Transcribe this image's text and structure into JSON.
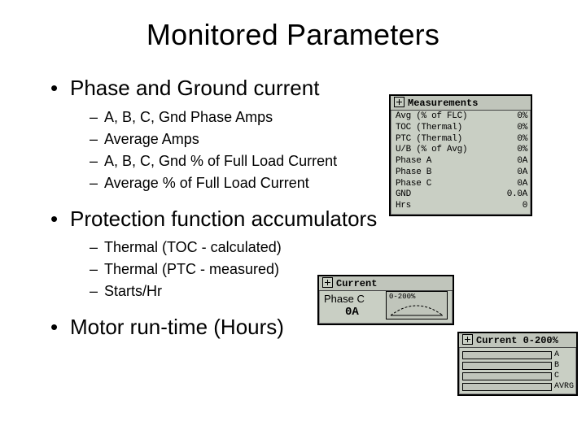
{
  "title": "Monitored Parameters",
  "section1": {
    "heading": "Phase and Ground current",
    "items": [
      "A, B, C, Gnd Phase Amps",
      "Average Amps",
      "A, B, C, Gnd % of Full Load Current",
      "Average % of Full Load Current"
    ]
  },
  "section2": {
    "heading": "Protection function accumulators",
    "items": [
      "Thermal (TOC - calculated)",
      "Thermal (PTC - measured)",
      "Starts/Hr"
    ]
  },
  "section3": {
    "heading": "Motor run-time (Hours)"
  },
  "panel": {
    "measurements": {
      "title": "Measurements",
      "rows": [
        {
          "label": "Avg (% of FLC)",
          "value": "0%"
        },
        {
          "label": "TOC (Thermal)",
          "value": "0%"
        },
        {
          "label": "PTC (Thermal)",
          "value": "0%"
        },
        {
          "label": "U/B (% of Avg)",
          "value": "0%"
        },
        {
          "label": "Phase A",
          "value": "0A"
        },
        {
          "label": "Phase B",
          "value": "0A"
        },
        {
          "label": "Phase C",
          "value": "0A"
        },
        {
          "label": "GND",
          "value": "0.0A"
        },
        {
          "label": "Hrs",
          "value": "0"
        }
      ]
    },
    "current": {
      "title": "Current",
      "phase_label": "Phase C",
      "phase_value": "0A",
      "range": "0-200%"
    },
    "bars": {
      "title": "Current 0-200%",
      "labels": [
        "A",
        "B",
        "C",
        "AVRG"
      ]
    }
  }
}
